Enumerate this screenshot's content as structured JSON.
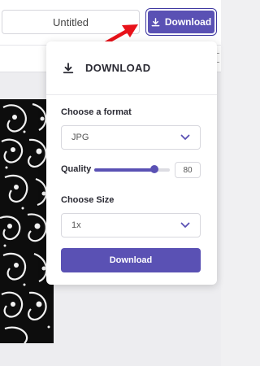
{
  "header": {
    "document_title": "Untitled",
    "download_button_label": "Download"
  },
  "download_panel": {
    "title": "DOWNLOAD",
    "format_label": "Choose a format",
    "format_value": "JPG",
    "quality_label": "Quality",
    "quality_value": "80",
    "quality_percent": 80,
    "size_label": "Choose Size",
    "size_value": "1x",
    "download_button_label": "Download"
  },
  "colors": {
    "accent": "#5a51b4",
    "annotation_arrow": "#e8121a"
  },
  "icons": [
    "download-icon",
    "chevron-down-icon",
    "arrow-annotation"
  ]
}
